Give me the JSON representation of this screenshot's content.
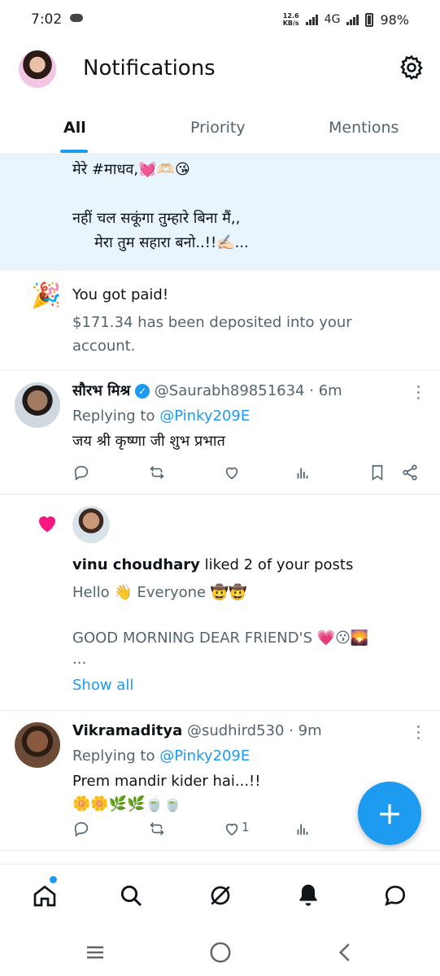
{
  "status_bar": {
    "time": "7:02",
    "speed_value": "12.6",
    "speed_unit": "KB/s",
    "network": "4G",
    "battery": "98%"
  },
  "header": {
    "title": "Notifications"
  },
  "tabs": [
    {
      "label": "All",
      "active": true
    },
    {
      "label": "Priority",
      "active": false
    },
    {
      "label": "Mentions",
      "active": false
    }
  ],
  "feed": {
    "highlighted": {
      "line1": "मेरे #माधव,💓🫶🏻😘",
      "line2": "नहीं चल सकूंगा तुम्हारे बिना मैं,,",
      "line3": "मेरा तुम सहारा बनो..!!✍🏻..."
    },
    "paid": {
      "icon": "🎉",
      "title": "You got paid!",
      "body_line1": "$171.34 has been deposited into your",
      "body_line2": "account."
    },
    "reply1": {
      "name": "सौरभ मिश्र",
      "handle": "@Saurabh89851634",
      "time": "· 6m",
      "replying_prefix": "Replying to",
      "replying_handle": "@Pinky209E",
      "text": "जय श्री कृष्णा जी शुभ प्रभात"
    },
    "like": {
      "user": "vinu choudhary",
      "action": "liked 2 of your posts",
      "line1": "Hello 👋 Everyone 🤠🤠",
      "line2": "GOOD MORNING DEAR FRIEND'S 💗😗🌄",
      "ellipsis": "...",
      "show_all": "Show all"
    },
    "reply2": {
      "name": "Vikramaditya",
      "handle": "@sudhird530",
      "time": "· 9m",
      "replying_prefix": "Replying to",
      "replying_handle": "@Pinky209E",
      "text": "Prem mandir kider hai...!!",
      "emoji": "🌼🌼🌿🌿🍵🍵",
      "like_count": "1"
    }
  },
  "fab": {
    "label": "+"
  },
  "colors": {
    "accent": "#1d9bf0",
    "like": "#f91880",
    "highlight_bg": "#e8f5fd"
  }
}
